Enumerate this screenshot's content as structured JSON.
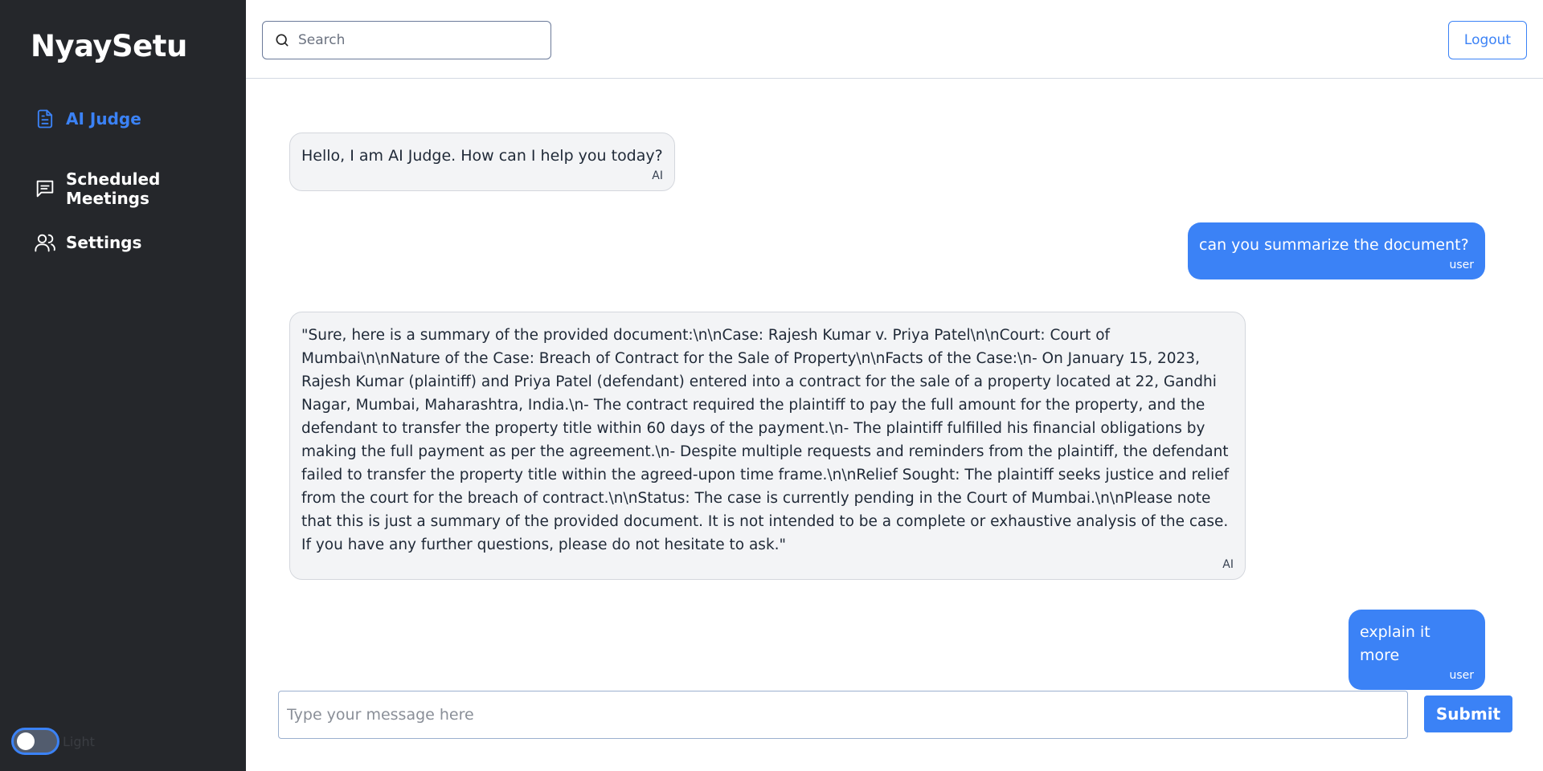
{
  "sidebar": {
    "brand": "NyaySetu",
    "items": [
      {
        "label": "AI Judge",
        "icon": "document-icon",
        "active": true
      },
      {
        "label": "Scheduled Meetings",
        "icon": "chat-icon",
        "active": false
      },
      {
        "label": "Settings",
        "icon": "users-icon",
        "active": false
      }
    ],
    "theme_toggle_label": "Light"
  },
  "header": {
    "search_placeholder": "Search",
    "logout_label": "Logout"
  },
  "chat": {
    "messages": [
      {
        "role": "AI",
        "text": "Hello, I am AI Judge. How can I help you today?"
      },
      {
        "role": "user",
        "text": "can you summarize the document?"
      },
      {
        "role": "AI",
        "text": "\"Sure, here is a summary of the provided document:\\n\\nCase: Rajesh Kumar v. Priya Patel\\n\\nCourt: Court of Mumbai\\n\\nNature of the Case: Breach of Contract for the Sale of Property\\n\\nFacts of the Case:\\n- On January 15, 2023, Rajesh Kumar (plaintiff) and Priya Patel (defendant) entered into a contract for the sale of a property located at 22, Gandhi Nagar, Mumbai, Maharashtra, India.\\n- The contract required the plaintiff to pay the full amount for the property, and the defendant to transfer the property title within 60 days of the payment.\\n- The plaintiff fulfilled his financial obligations by making the full payment as per the agreement.\\n- Despite multiple requests and reminders from the plaintiff, the defendant failed to transfer the property title within the agreed-upon time frame.\\n\\nRelief Sought: The plaintiff seeks justice and relief from the court for the breach of contract.\\n\\nStatus: The case is currently pending in the Court of Mumbai.\\n\\nPlease note that this is just a summary of the provided document. It is not intended to be a complete or exhaustive analysis of the case. If you have any further questions, please do not hesitate to ask.\""
      },
      {
        "role": "user",
        "text": "explain it more"
      }
    ]
  },
  "composer": {
    "placeholder": "Type your message here",
    "submit_label": "Submit"
  },
  "colors": {
    "sidebar_bg": "#25272b",
    "accent": "#3b82f6",
    "ai_bubble": "#f3f4f6"
  }
}
